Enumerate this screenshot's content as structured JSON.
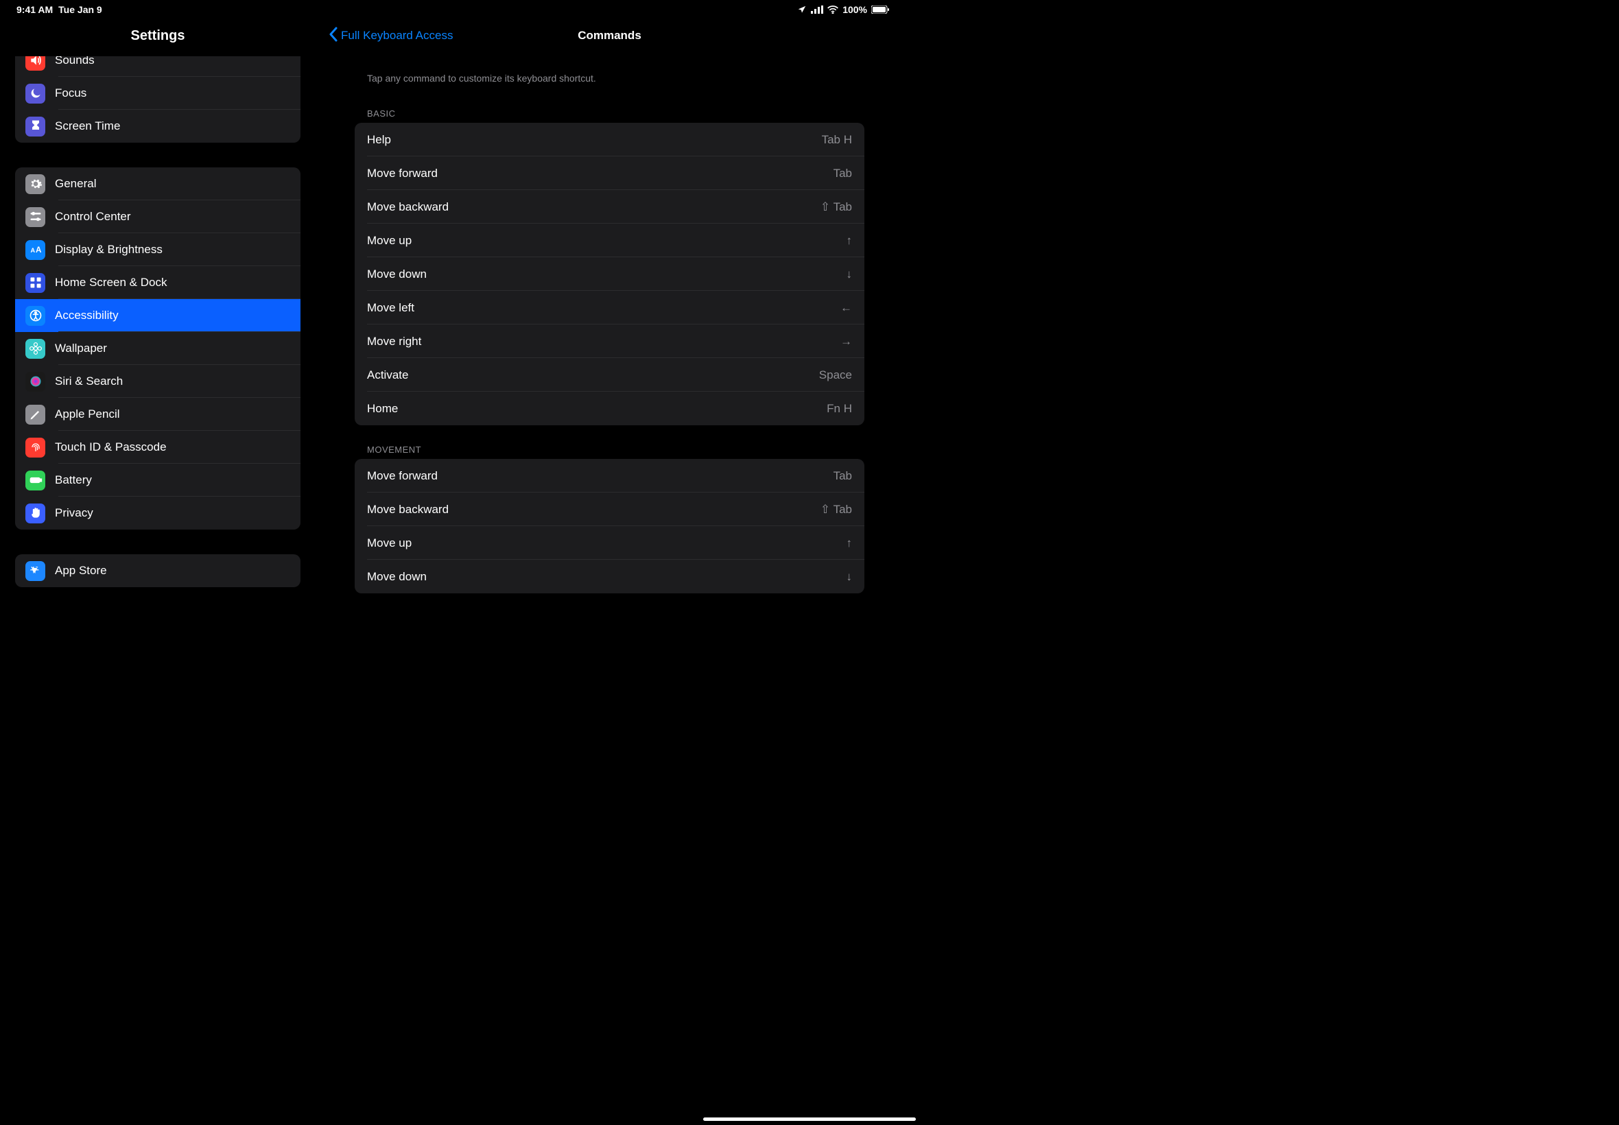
{
  "status": {
    "time": "9:41 AM",
    "date": "Tue Jan 9",
    "battery": "100%"
  },
  "sidebar": {
    "title": "Settings",
    "groups": [
      {
        "items": [
          {
            "label": "Sounds",
            "icon": "speaker",
            "color": "#ff3b30"
          },
          {
            "label": "Focus",
            "icon": "moon",
            "color": "#5856d6"
          },
          {
            "label": "Screen Time",
            "icon": "hourglass",
            "color": "#5856d6"
          }
        ]
      },
      {
        "items": [
          {
            "label": "General",
            "icon": "gear",
            "color": "#8e8e93"
          },
          {
            "label": "Control Center",
            "icon": "slider",
            "color": "#8e8e93"
          },
          {
            "label": "Display & Brightness",
            "icon": "letters",
            "color": "#0a84ff"
          },
          {
            "label": "Home Screen & Dock",
            "icon": "grid",
            "color": "#3051e3"
          },
          {
            "label": "Accessibility",
            "icon": "access",
            "color": "#0a84ff",
            "selected": true
          },
          {
            "label": "Wallpaper",
            "icon": "flower",
            "color": "#36c9c9"
          },
          {
            "label": "Siri & Search",
            "icon": "siri",
            "color": "#1a1a1a"
          },
          {
            "label": "Apple Pencil",
            "icon": "pencil",
            "color": "#8e8e93"
          },
          {
            "label": "Touch ID & Passcode",
            "icon": "finger",
            "color": "#ff3b30"
          },
          {
            "label": "Battery",
            "icon": "battery",
            "color": "#30d158"
          },
          {
            "label": "Privacy",
            "icon": "hand",
            "color": "#3a5fff"
          }
        ]
      },
      {
        "items": [
          {
            "label": "App Store",
            "icon": "appstore",
            "color": "#1d87ff"
          }
        ]
      }
    ]
  },
  "detail": {
    "back": "Full Keyboard Access",
    "title": "Commands",
    "subtitle": "Tap any command to customize its keyboard shortcut.",
    "sections": [
      {
        "header": "BASIC",
        "rows": [
          {
            "label": "Help",
            "value": "Tab H"
          },
          {
            "label": "Move forward",
            "value": "Tab"
          },
          {
            "label": "Move backward",
            "value": "⇧ Tab"
          },
          {
            "label": "Move up",
            "value": "↑"
          },
          {
            "label": "Move down",
            "value": "↓"
          },
          {
            "label": "Move left",
            "value": "←"
          },
          {
            "label": "Move right",
            "value": "→"
          },
          {
            "label": "Activate",
            "value": "Space"
          },
          {
            "label": "Home",
            "value": "Fn H"
          }
        ]
      },
      {
        "header": "MOVEMENT",
        "rows": [
          {
            "label": "Move forward",
            "value": "Tab"
          },
          {
            "label": "Move backward",
            "value": "⇧ Tab"
          },
          {
            "label": "Move up",
            "value": "↑"
          },
          {
            "label": "Move down",
            "value": "↓"
          }
        ]
      }
    ]
  }
}
